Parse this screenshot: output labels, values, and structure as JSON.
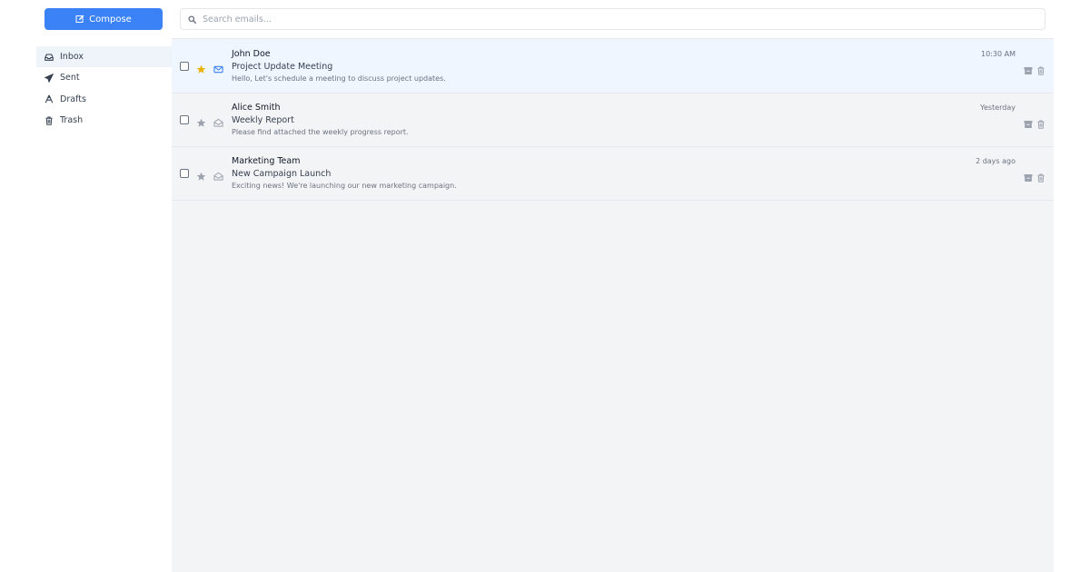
{
  "sidebar": {
    "compose_label": "Compose",
    "items": [
      {
        "label": "Inbox",
        "icon": "inbox-icon"
      },
      {
        "label": "Sent",
        "icon": "send-icon"
      },
      {
        "label": "Drafts",
        "icon": "drafts-icon"
      },
      {
        "label": "Trash",
        "icon": "trash-icon"
      }
    ]
  },
  "search": {
    "placeholder": "Search emails...",
    "value": ""
  },
  "emails": [
    {
      "sender": "John Doe",
      "subject": "Project Update Meeting",
      "preview": "Hello, Let's schedule a meeting to discuss project updates.",
      "time": "10:30 AM",
      "starred": true,
      "unread": true
    },
    {
      "sender": "Alice Smith",
      "subject": "Weekly Report",
      "preview": "Please find attached the weekly progress report.",
      "time": "Yesterday",
      "starred": false,
      "unread": false
    },
    {
      "sender": "Marketing Team",
      "subject": "New Campaign Launch",
      "preview": "Exciting news! We're launching our new marketing campaign.",
      "time": "2 days ago",
      "starred": false,
      "unread": false
    }
  ],
  "colors": {
    "accent": "#3b82f6",
    "star_active": "#eab308",
    "star_inactive": "#9ca3af",
    "unread_bg": "#eff6ff"
  }
}
